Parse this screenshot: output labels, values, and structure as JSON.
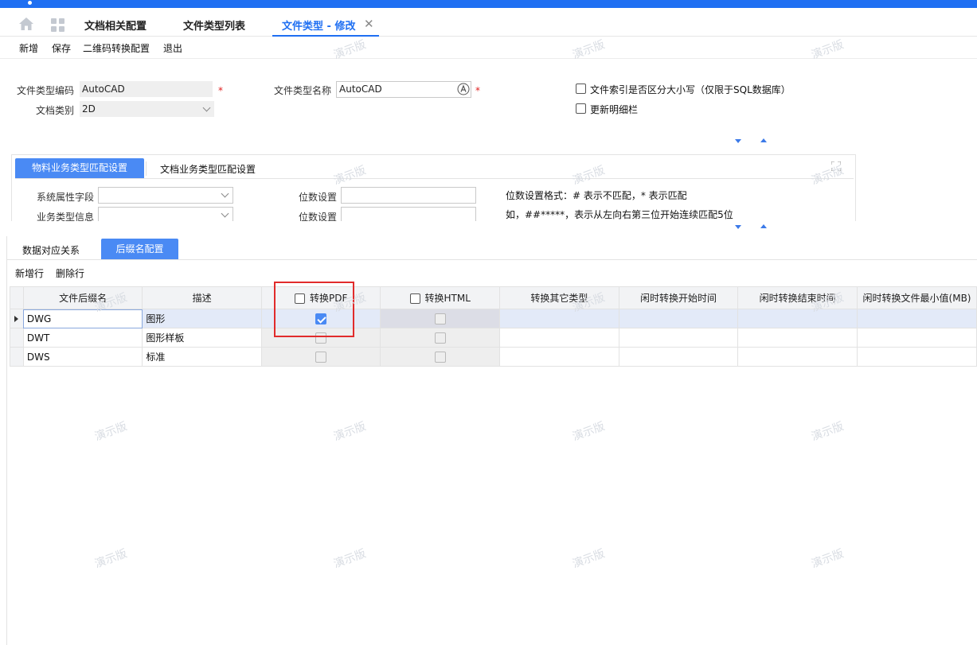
{
  "tabs": [
    {
      "label": "文档相关配置"
    },
    {
      "label": "文件类型列表"
    },
    {
      "label": "文件类型 - 修改"
    }
  ],
  "toolbar": {
    "new": "新增",
    "save": "保存",
    "qr": "二维码转换配置",
    "exit": "退出"
  },
  "form": {
    "code_label": "文件类型编码",
    "code_value": "AutoCAD",
    "category_label": "文档类别",
    "category_value": "2D",
    "name_label": "文件类型名称",
    "name_value": "AutoCAD",
    "required_mark": "*",
    "case_sensitive_label": "文件索引是否区分大小写（仅限于SQL数据库）",
    "update_detail_label": "更新明细栏"
  },
  "match_panel": {
    "tab_active": "物料业务类型匹配设置",
    "tab_other": "文档业务类型匹配设置",
    "field1_label": "系统属性字段",
    "field2_label": "业务类型信息",
    "digit1_label": "位数设置",
    "digit2_label": "位数设置",
    "hint1": "位数设置格式：# 表示不匹配，* 表示匹配",
    "hint2": "如，##*****，表示从左向右第三位开始连续匹配5位"
  },
  "grid_panel": {
    "tab_data": "数据对应关系",
    "tab_suffix": "后缀名配置",
    "add_row": "新增行",
    "delete_row": "删除行",
    "columns": [
      "文件后缀名",
      "描述",
      "转换PDF",
      "转换HTML",
      "转换其它类型",
      "闲时转换开始时间",
      "闲时转换结束时间",
      "闲时转换文件最小值(MB)"
    ],
    "rows": [
      {
        "suffix": "DWG",
        "desc": "图形",
        "pdf": true,
        "html": false
      },
      {
        "suffix": "DWT",
        "desc": "图形样板",
        "pdf": false,
        "html": false
      },
      {
        "suffix": "DWS",
        "desc": "标准",
        "pdf": false,
        "html": false
      }
    ]
  },
  "watermark": "演示版",
  "colors": {
    "brand": "#1f6ff2",
    "tab_active": "#4a8af4",
    "highlight": "#e12b2b"
  }
}
